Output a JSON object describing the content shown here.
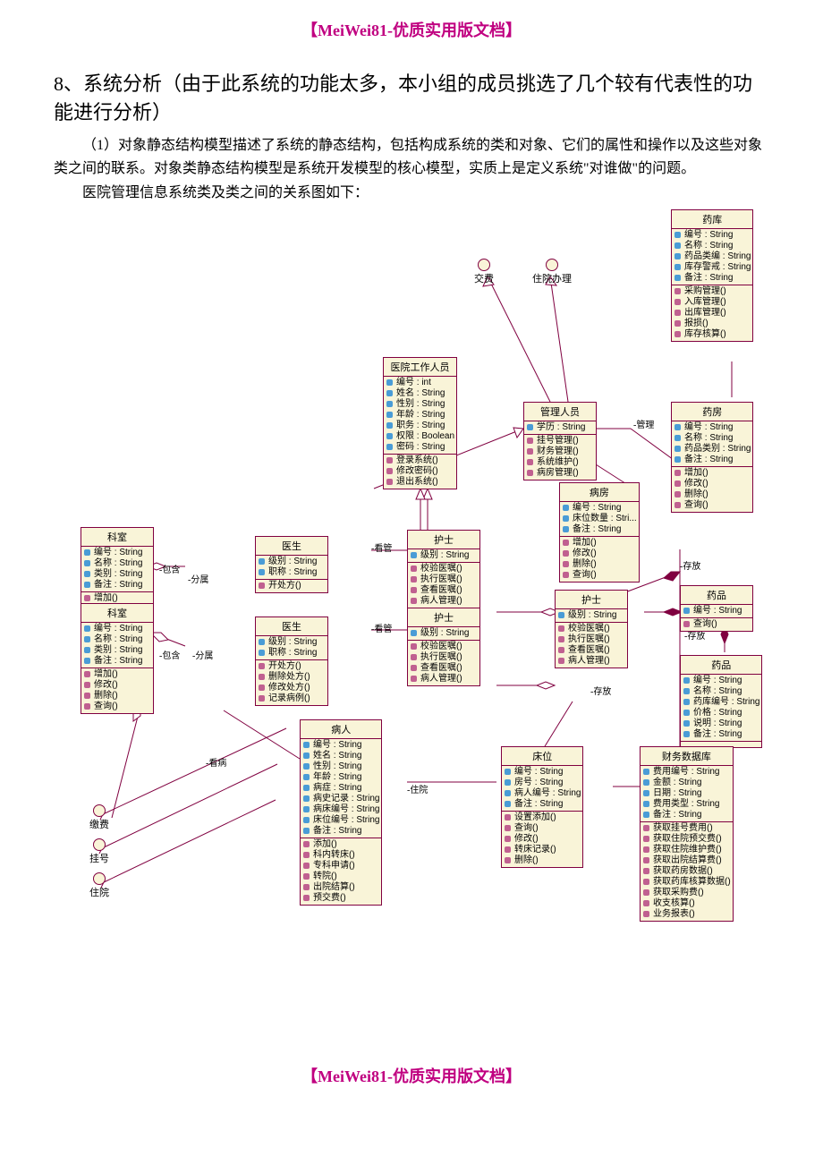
{
  "doc": {
    "header": "【MeiWei81-优质实用版文档】",
    "footer": "【MeiWei81-优质实用版文档】",
    "title": "8、系统分析（由于此系统的功能太多，本小组的成员挑选了几个较有代表性的功能进行分析）",
    "p1": "（1）对象静态结构模型描述了系统的静态结构，包括构成系统的类和对象、它们的属性和操作以及这些对象类之间的联系。对象类静态结构模型是系统开发模型的核心模型，实质上是定义系统\"对谁做\"的问题。",
    "p2": "医院管理信息系统类及类之间的关系图如下："
  },
  "iface": {
    "jf": "交费",
    "zy": "住院办理",
    "jfei": "缴费",
    "gh": "挂号",
    "zyuan": "住院"
  },
  "lbl": {
    "gl": "-管理",
    "bh": "-包含",
    "fs": "-分属",
    "kg": "-看管",
    "cf": "-存放",
    "kb": "-看病",
    "zy": "-住院"
  },
  "cls": {
    "yk": {
      "n": "药库",
      "a": [
        [
          "编号",
          "String"
        ],
        [
          "名称",
          "String"
        ],
        [
          "药品类编",
          "String"
        ],
        [
          "库存警戒",
          "String"
        ],
        [
          "备注",
          "String"
        ]
      ],
      "o": [
        "采购管理()",
        "入库管理()",
        "出库管理()",
        "报损()",
        "库存核算()"
      ]
    },
    "yygzry": {
      "n": "医院工作人员",
      "a": [
        [
          "编号",
          "int"
        ],
        [
          "姓名",
          "String"
        ],
        [
          "性别",
          "String"
        ],
        [
          "年龄",
          "String"
        ],
        [
          "职务",
          "String"
        ],
        [
          "权限",
          "Boolean"
        ],
        [
          "密码",
          "String"
        ]
      ],
      "o": [
        "登录系统()",
        "修改密码()",
        "退出系统()"
      ]
    },
    "glry": {
      "n": "管理人员",
      "a": [
        [
          "学历",
          "String"
        ]
      ],
      "o": [
        "挂号管理()",
        "财务管理()",
        "系统维护()",
        "病房管理()"
      ]
    },
    "yf": {
      "n": "药房",
      "a": [
        [
          "编号",
          "String"
        ],
        [
          "名称",
          "String"
        ],
        [
          "药品类别",
          "String"
        ],
        [
          "备注",
          "String"
        ]
      ],
      "o": [
        "增加()",
        "修改()",
        "删除()",
        "查询()"
      ]
    },
    "bf": {
      "n": "病房",
      "a": [
        [
          "编号",
          "String"
        ],
        [
          "床位数量",
          "Stri..."
        ],
        [
          "备注",
          "String"
        ]
      ],
      "o": [
        "增加()",
        "修改()",
        "删除()",
        "查询()"
      ]
    },
    "ks1": {
      "n": "科室",
      "a": [
        [
          "编号",
          "String"
        ],
        [
          "名称",
          "String"
        ],
        [
          "类别",
          "String"
        ],
        [
          "备注",
          "String"
        ]
      ],
      "o": [
        "增加()"
      ]
    },
    "ys1": {
      "n": "医生",
      "a": [
        [
          "级别",
          "String"
        ],
        [
          "职称",
          "String"
        ]
      ],
      "o": [
        "开处方()"
      ]
    },
    "hs1": {
      "n": "护士",
      "a": [
        [
          "级别",
          "String"
        ]
      ],
      "o": [
        "校验医嘱()",
        "执行医嘱()",
        "查看医嘱()",
        "病人管理()"
      ]
    },
    "yp1": {
      "n": "药品",
      "a": [
        [
          "编号",
          "String"
        ]
      ],
      "o": [
        "查询()"
      ]
    },
    "ks2": {
      "n": "科室",
      "a": [
        [
          "编号",
          "String"
        ],
        [
          "名称",
          "String"
        ],
        [
          "类别",
          "String"
        ],
        [
          "备注",
          "String"
        ]
      ],
      "o": [
        "增加()",
        "修改()",
        "删除()",
        "查询()"
      ]
    },
    "ys2": {
      "n": "医生",
      "a": [
        [
          "级别",
          "String"
        ],
        [
          "职称",
          "String"
        ]
      ],
      "o": [
        "开处方()",
        "删除处方()",
        "修改处方()",
        "记录病例()"
      ]
    },
    "hs2": {
      "n": "护士",
      "a": [
        [
          "级别",
          "String"
        ]
      ],
      "o": [
        "校验医嘱()",
        "执行医嘱()",
        "查看医嘱()",
        "病人管理()"
      ]
    },
    "yp2": {
      "n": "药品",
      "a": [
        [
          "编号",
          "String"
        ],
        [
          "名称",
          "String"
        ],
        [
          "药库编号",
          "String"
        ],
        [
          "价格",
          "String"
        ],
        [
          "说明",
          "String"
        ],
        [
          "备注",
          "String"
        ]
      ],
      "o": []
    },
    "br": {
      "n": "病人",
      "a": [
        [
          "编号",
          "String"
        ],
        [
          "姓名",
          "String"
        ],
        [
          "性别",
          "String"
        ],
        [
          "年龄",
          "String"
        ],
        [
          "病症",
          "String"
        ],
        [
          "病史记录",
          "String"
        ],
        [
          "病床编号",
          "String"
        ],
        [
          "床位编号",
          "String"
        ],
        [
          "备注",
          "String"
        ]
      ],
      "o": [
        "添加()",
        "科内转床()",
        "专科申请()",
        "转院()",
        "出院结算()",
        "预交费()"
      ]
    },
    "cw": {
      "n": "床位",
      "a": [
        [
          "编号",
          "String"
        ],
        [
          "房号",
          "String"
        ],
        [
          "病人编号",
          "String"
        ],
        [
          "备注",
          "String"
        ]
      ],
      "o": [
        "设置添加()",
        "查询()",
        "修改()",
        "转床记录()",
        "删除()"
      ]
    },
    "cwsj": {
      "n": "财务数据库",
      "a": [
        [
          "费用编号",
          "String"
        ],
        [
          "金额",
          "String"
        ],
        [
          "日期",
          "String"
        ],
        [
          "费用类型",
          "String"
        ],
        [
          "备注",
          "String"
        ]
      ],
      "o": [
        "获取挂号费用()",
        "获取住院预交费()",
        "获取住院维护费()",
        "获取出院结算费()",
        "获取药房数据()",
        "获取药库核算数据()",
        "获取采购费()",
        "收支核算()",
        "业务报表()"
      ]
    }
  }
}
